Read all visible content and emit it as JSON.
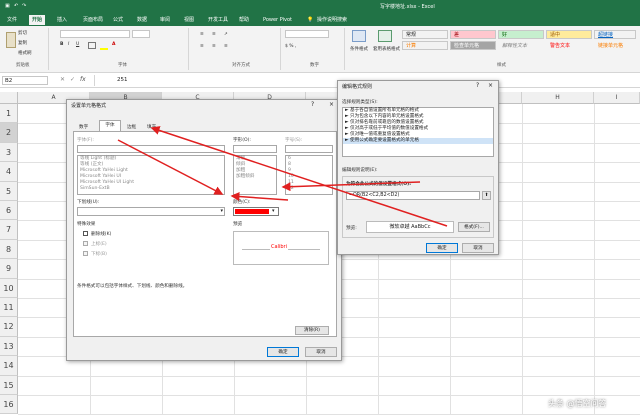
{
  "title_bar": {
    "title": "写字楼地址.xlsx  -  Excel"
  },
  "tabs": [
    "文件",
    "开始",
    "插入",
    "页面布局",
    "公式",
    "数据",
    "审阅",
    "视图",
    "开发工具",
    "帮助",
    "Power Pivot"
  ],
  "tell_me": "操作说明搜索",
  "ribbon": {
    "cut": "剪切",
    "copy": "复制",
    "format_painter": "格式刷",
    "clipboard_label": "剪贴板",
    "font_label": "字体",
    "align_label": "对齐方式",
    "number_label": "数字",
    "styles_label": "样式",
    "conditional_format": "条件格式",
    "table_format": "套用表格格式",
    "styles": [
      {
        "label": "常规",
        "bg": "#ffffff",
        "color": "#222222"
      },
      {
        "label": "差",
        "bg": "#ffc7ce",
        "color": "#9c0006"
      },
      {
        "label": "好",
        "bg": "#c6efce",
        "color": "#006100"
      },
      {
        "label": "适中",
        "bg": "#ffeb9c",
        "color": "#9c5700"
      },
      {
        "label": "超链接",
        "bg": "#ffffff",
        "color": "#0563c1"
      },
      {
        "label": "计算",
        "bg": "#f2f2f2",
        "color": "#fa7d00"
      },
      {
        "label": "检查单元格",
        "bg": "#a5a5a5",
        "color": "#ffffff"
      },
      {
        "label": "解释性文本",
        "bg": "#ffffff",
        "color": "#7f7f7f"
      },
      {
        "label": "警告文本",
        "bg": "#ffffff",
        "color": "#ff0000"
      },
      {
        "label": "链接单元格",
        "bg": "#ffffff",
        "color": "#fa7d00"
      }
    ]
  },
  "formula_bar": {
    "name_box": "B2",
    "fx": "fx",
    "value": "251"
  },
  "columns": [
    "A",
    "B",
    "C",
    "D",
    "E",
    "F",
    "G",
    "H",
    "I"
  ],
  "rows": [
    "1",
    "2",
    "3",
    "4",
    "5",
    "6",
    "7",
    "8",
    "9",
    "10",
    "11",
    "12",
    "13",
    "14",
    "15",
    "16"
  ],
  "format_dialog": {
    "title": "设置单元格格式",
    "help": "?",
    "close": "×",
    "tabs": [
      "数字",
      "字体",
      "边框",
      "填充"
    ],
    "font_label": "字体(F):",
    "font_list": [
      "等线 Light (标题)",
      "等线 (正文)",
      "Microsoft YaHei Light",
      "Microsoft YaHei UI",
      "Microsoft YaHei UI Light",
      "SimSun-ExtB"
    ],
    "style_label": "字形(O):",
    "style_list": [
      "常规",
      "倾斜",
      "加粗",
      "加粗倾斜"
    ],
    "size_label": "字号(S):",
    "size_list": [
      "6",
      "8",
      "9",
      "10",
      "11",
      "12"
    ],
    "underline_label": "下划线(U):",
    "color_label": "颜色(C):",
    "color_value": "#ff0000",
    "effects_label": "特殊效果",
    "strike": "删除线(K)",
    "superscript": "上标(E)",
    "subscript": "下标(B)",
    "preview_label": "预览",
    "preview_text": "Calibri",
    "note": "条件格式可以包括字体样式、下划线、颜色和删除线。",
    "clear": "清除(R)",
    "ok": "确定",
    "cancel": "取消"
  },
  "rule_dialog": {
    "title": "编辑格式规则",
    "help": "?",
    "close": "×",
    "type_label": "选择规则类型(S):",
    "rule_types": [
      "基于各自值设置所有单元格的格式",
      "只为包含以下内容的单元格设置格式",
      "仅对排名靠前或靠后的数值设置格式",
      "仅对高于或低于平均值的数值设置格式",
      "仅对唯一值或重复值设置格式",
      "使用公式确定要设置格式的单元格"
    ],
    "desc_label": "编辑规则说明(E):",
    "formula_label": "为符合此公式的值设置格式(O):",
    "formula": "=OR(B2<C2,B2<D2)",
    "preview_label": "预览:",
    "preview_text": "微软卓越  AaBbCc",
    "format_btn": "格式(F)...",
    "ok": "确定",
    "cancel": "取消"
  },
  "watermark": "头条 @悟空问答",
  "accent": "#217346",
  "arrow_color": "#e02020"
}
